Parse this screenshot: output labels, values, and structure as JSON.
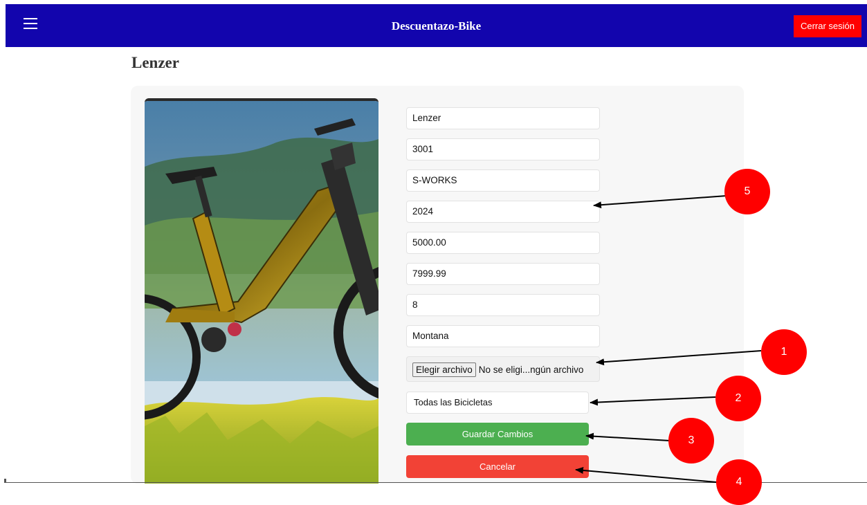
{
  "header": {
    "title": "Descuentazo-Bike",
    "logout_label": "Cerrar sesión",
    "menu_icon": "hamburger-menu-icon",
    "background_color": "#1205ad",
    "logout_color": "#ff0000"
  },
  "page": {
    "title": "Lenzer"
  },
  "form": {
    "fields": [
      {
        "value": "Lenzer"
      },
      {
        "value": "3001"
      },
      {
        "value": "S-WORKS"
      },
      {
        "value": "2024"
      },
      {
        "value": "5000.00"
      },
      {
        "value": "7999.99"
      },
      {
        "value": "8"
      },
      {
        "value": "Montana"
      }
    ],
    "file": {
      "button_label": "Elegir archivo",
      "status": "No se eligi...ngún archivo"
    },
    "category": {
      "selected": "Todas las Bicicletas"
    },
    "save_label": "Guardar Cambios",
    "cancel_label": "Cancelar",
    "save_color": "#4caf50",
    "cancel_color": "#f24236"
  },
  "annotations": [
    {
      "number": "1"
    },
    {
      "number": "2"
    },
    {
      "number": "3"
    },
    {
      "number": "4"
    },
    {
      "number": "5"
    }
  ]
}
